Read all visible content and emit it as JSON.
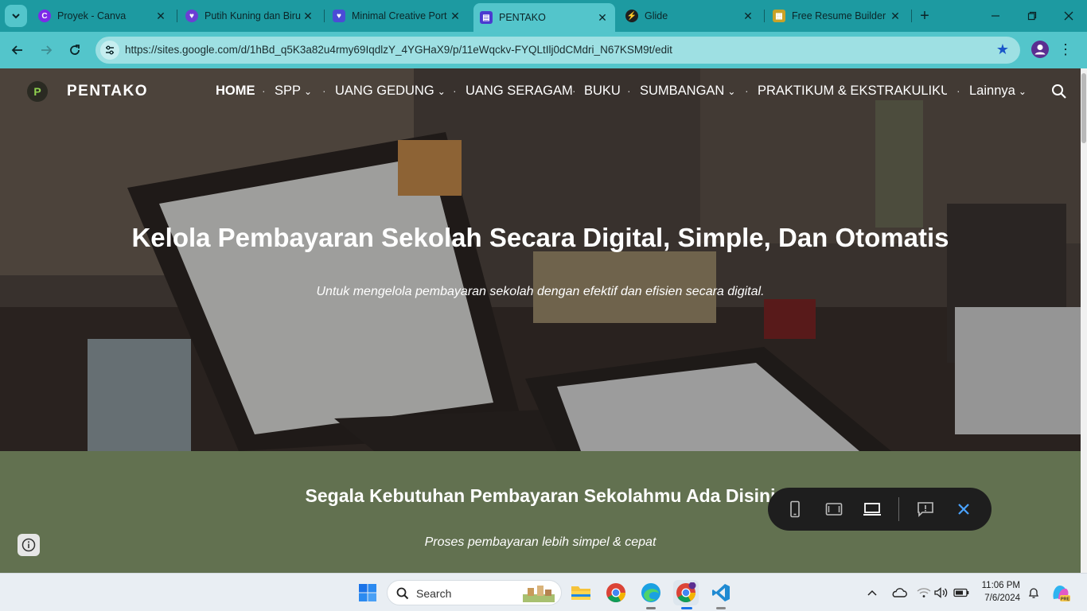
{
  "browser": {
    "tabs": [
      {
        "title": "Proyek - Canva",
        "icon": "canva-icon",
        "color": "#7d2ae8",
        "active": false
      },
      {
        "title": "Putih Kuning dan Biru",
        "icon": "heart-icon",
        "color": "#6b3fd4",
        "active": false
      },
      {
        "title": "Minimal Creative Port",
        "icon": "shield-icon",
        "color": "#4b4bd6",
        "active": false
      },
      {
        "title": "PENTAKO",
        "icon": "google-sites-icon",
        "color": "#4a3ad0",
        "active": true
      },
      {
        "title": "Glide",
        "icon": "glide-icon",
        "color": "#1f1f1f",
        "active": false
      },
      {
        "title": "Free Resume Builder",
        "icon": "resume-icon",
        "color": "#c9a227",
        "active": false
      }
    ],
    "url": "https://sites.google.com/d/1hBd_q5K3a82u4rmy69IqdlzY_4YGHaX9/p/11eWqckv-FYQLtIlj0dCMdri_N67KSM9t/edit"
  },
  "site": {
    "logo_letter": "P",
    "name": "PENTAKO",
    "nav": [
      "HOME",
      "SPP",
      "UANG GEDUNG",
      "UANG SERAGAM",
      "BUKU",
      "SUMBANGAN",
      "PRAKTIKUM & EKSTRAKULIKU...",
      "Lainnya"
    ],
    "hero_title": "Kelola Pembayaran Sekolah Secara Digital, Simple, Dan Otomatis",
    "hero_subtitle": "Untuk mengelola pembayaran sekolah dengan efektif dan efisien secara digital.",
    "section2_title": "Segala Kebutuhan Pembayaran Sekolahmu Ada Disini",
    "section2_subtitle": "Proses pembayaran lebih simpel & cepat",
    "section2_bg": "#627150"
  },
  "preview_toolbar": {
    "buttons": [
      "phone-preview-icon",
      "tablet-preview-icon",
      "laptop-preview-icon",
      "feedback-icon",
      "close-icon"
    ],
    "selected": "laptop-preview-icon"
  },
  "taskbar": {
    "search_label": "Search",
    "time": "11:06 PM",
    "date": "7/6/2024"
  }
}
